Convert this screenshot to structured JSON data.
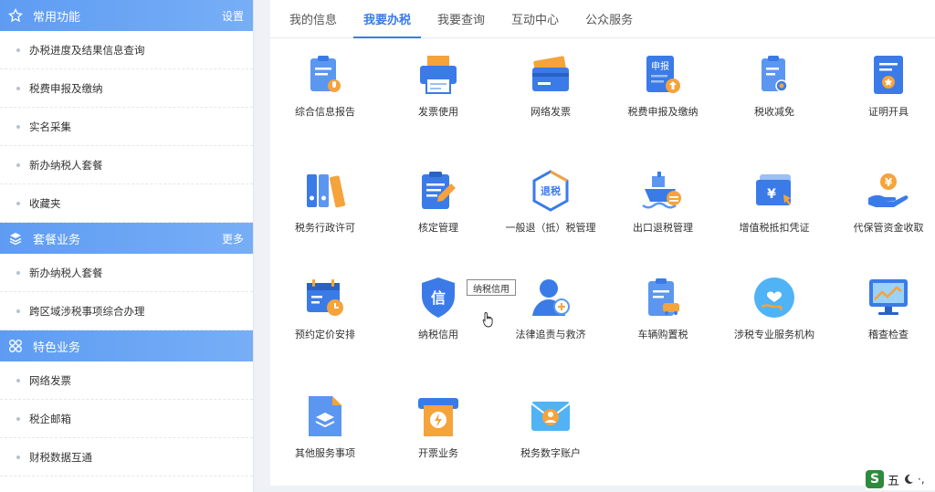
{
  "sidebar": {
    "common": {
      "title": "常用功能",
      "link": "设置",
      "items": [
        "办税进度及结果信息查询",
        "税费申报及缴纳",
        "实名采集",
        "新办纳税人套餐",
        "收藏夹"
      ]
    },
    "package": {
      "title": "套餐业务",
      "link": "更多",
      "items": [
        "新办纳税人套餐",
        "跨区域涉税事项综合办理"
      ]
    },
    "special": {
      "title": "特色业务",
      "items": [
        "网络发票",
        "税企邮箱",
        "财税数据互通"
      ]
    }
  },
  "tabs": [
    "我的信息",
    "我要办税",
    "我要查询",
    "互动中心",
    "公众服务"
  ],
  "active_tab": "我要办税",
  "tiles": [
    "综合信息报告",
    "发票使用",
    "网络发票",
    "税费申报及缴纳",
    "税收减免",
    "证明开具",
    "税务行政许可",
    "核定管理",
    "一般退（抵）税管理",
    "出口退税管理",
    "增值税抵扣凭证",
    "代保管资金收取",
    "预约定价安排",
    "纳税信用",
    "法律追责与救济",
    "车辆购置税",
    "涉税专业服务机构",
    "稽查检查",
    "其他服务事项",
    "开票业务",
    "税务数字账户"
  ],
  "icon_text": {
    "declare": "申报",
    "refund": "退税",
    "credit": "信",
    "yuan": "¥"
  },
  "tooltip": "纳税信用",
  "ime": {
    "logo": "S",
    "mode": "五"
  },
  "colors": {
    "primary": "#3a7be8",
    "orange": "#f5a33b",
    "header": "#5e9cf3"
  }
}
